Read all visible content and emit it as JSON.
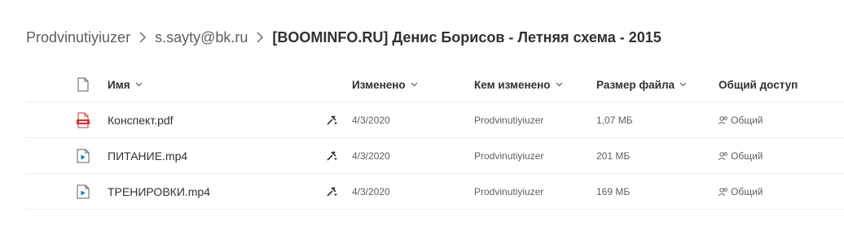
{
  "breadcrumb": {
    "items": [
      "Prodvinutiyiuzer",
      "s.sayty@bk.ru"
    ],
    "current": "[BOOMINFO.RU] Денис Борисов - Летняя схема - 2015"
  },
  "columns": {
    "name": "Имя",
    "modified": "Изменено",
    "modified_by": "Кем изменено",
    "size": "Размер файла",
    "sharing": "Общий доступ"
  },
  "files": [
    {
      "name": "Конспект.pdf",
      "type_icon": "pdf-file-icon",
      "modified": "4/3/2020",
      "modified_by": "Prodvinutiyiuzer",
      "size": "1,07 МБ",
      "sharing": "Общий"
    },
    {
      "name": "ПИТАНИЕ.mp4",
      "type_icon": "video-file-icon",
      "modified": "4/3/2020",
      "modified_by": "Prodvinutiyiuzer",
      "size": "201 МБ",
      "sharing": "Общий"
    },
    {
      "name": "ТРЕНИРОВКИ.mp4",
      "type_icon": "video-file-icon",
      "modified": "4/3/2020",
      "modified_by": "Prodvinutiyiuzer",
      "size": "169 МБ",
      "sharing": "Общий"
    }
  ],
  "colors": {
    "pdf": "#d13438",
    "video": "#0078d4",
    "text": "#323130",
    "secondary": "#605e5c"
  }
}
